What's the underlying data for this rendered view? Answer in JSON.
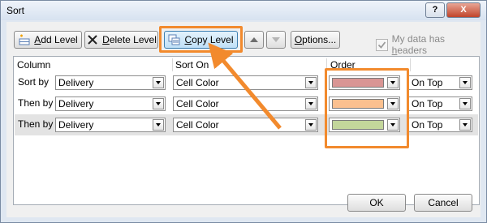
{
  "window": {
    "title": "Sort",
    "help_label": "?",
    "close_label": "X"
  },
  "toolbar": {
    "add_level": {
      "prefix": "",
      "accel": "A",
      "rest": "dd Level"
    },
    "delete_level": {
      "accel": "D",
      "rest": "elete Level"
    },
    "copy_level": {
      "accel": "C",
      "rest": "opy Level"
    },
    "options": {
      "accel": "O",
      "rest": "ptions..."
    },
    "headers_checkbox": {
      "checked": true,
      "label_pre": "My data has ",
      "accel": "h",
      "label_post": "eaders"
    }
  },
  "grid": {
    "headers": {
      "column": "Column",
      "sort_on": "Sort On",
      "order": "Order"
    },
    "rows": [
      {
        "label": "Sort by",
        "column": "Delivery",
        "sort_on": "Cell Color",
        "color": "#d99594",
        "position": "On Top"
      },
      {
        "label": "Then by",
        "column": "Delivery",
        "sort_on": "Cell Color",
        "color": "#fbc08f",
        "position": "On Top"
      },
      {
        "label": "Then by",
        "column": "Delivery",
        "sort_on": "Cell Color",
        "color": "#c3d69b",
        "position": "On Top"
      }
    ]
  },
  "footer": {
    "ok_label": "OK",
    "cancel_label": "Cancel"
  },
  "colors": {
    "highlight": "#f28a2d",
    "selected_row": "#e3e3e3"
  }
}
